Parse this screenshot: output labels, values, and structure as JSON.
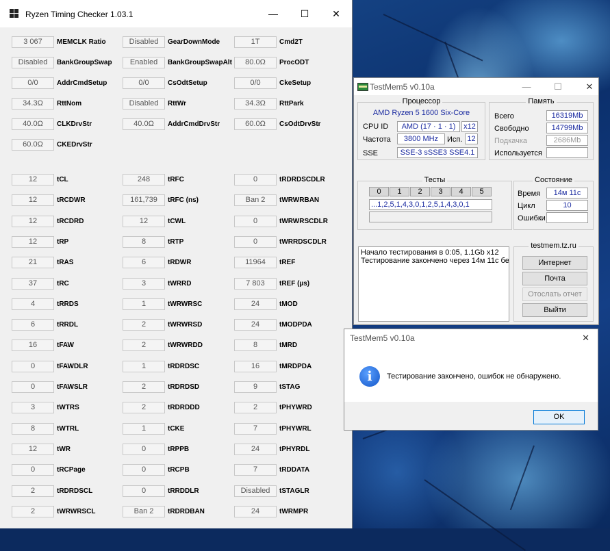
{
  "rtc": {
    "title": "Ryzen Timing Checker 1.03.1",
    "minimize": "—",
    "maximize": "☐",
    "close": "✕",
    "col1": [
      {
        "value": "3 067",
        "label": "MEMCLK Ratio"
      },
      {
        "value": "Disabled",
        "label": "BankGroupSwap"
      },
      {
        "value": "0/0",
        "label": "AddrCmdSetup"
      },
      {
        "value": "34.3Ω",
        "label": "RttNom"
      },
      {
        "value": "40.0Ω",
        "label": "CLKDrvStr"
      },
      {
        "value": "60.0Ω",
        "label": "CKEDrvStr"
      },
      {
        "value": "12",
        "label": "tCL"
      },
      {
        "value": "12",
        "label": "tRCDWR"
      },
      {
        "value": "12",
        "label": "tRCDRD"
      },
      {
        "value": "12",
        "label": "tRP"
      },
      {
        "value": "21",
        "label": "tRAS"
      },
      {
        "value": "37",
        "label": "tRC"
      },
      {
        "value": "4",
        "label": "tRRDS"
      },
      {
        "value": "6",
        "label": "tRRDL"
      },
      {
        "value": "16",
        "label": "tFAW"
      },
      {
        "value": "0",
        "label": "tFAWDLR"
      },
      {
        "value": "0",
        "label": "tFAWSLR"
      },
      {
        "value": "3",
        "label": "tWTRS"
      },
      {
        "value": "8",
        "label": "tWTRL"
      },
      {
        "value": "12",
        "label": "tWR"
      },
      {
        "value": "0",
        "label": "tRCPage"
      },
      {
        "value": "2",
        "label": "tRDRDSCL"
      },
      {
        "value": "2",
        "label": "tWRWRSCL"
      }
    ],
    "col2": [
      {
        "value": "Disabled",
        "label": "GearDownMode"
      },
      {
        "value": "Enabled",
        "label": "BankGroupSwapAlt"
      },
      {
        "value": "0/0",
        "label": "CsOdtSetup"
      },
      {
        "value": "Disabled",
        "label": "RttWr"
      },
      {
        "value": "40.0Ω",
        "label": "AddrCmdDrvStr"
      },
      {
        "value": "248",
        "label": "tRFC"
      },
      {
        "value": "161,739",
        "label": "tRFC (ns)"
      },
      {
        "value": "12",
        "label": "tCWL"
      },
      {
        "value": "8",
        "label": "tRTP"
      },
      {
        "value": "6",
        "label": "tRDWR"
      },
      {
        "value": "3",
        "label": "tWRRD"
      },
      {
        "value": "1",
        "label": "tWRWRSC"
      },
      {
        "value": "2",
        "label": "tWRWRSD"
      },
      {
        "value": "2",
        "label": "tWRWRDD"
      },
      {
        "value": "1",
        "label": "tRDRDSC"
      },
      {
        "value": "2",
        "label": "tRDRDSD"
      },
      {
        "value": "2",
        "label": "tRDRDDD"
      },
      {
        "value": "1",
        "label": "tCKE"
      },
      {
        "value": "0",
        "label": "tRPPB"
      },
      {
        "value": "0",
        "label": "tRCPB"
      },
      {
        "value": "0",
        "label": "tRRDDLR"
      },
      {
        "value": "Ban 2",
        "label": "tRDRDBAN"
      }
    ],
    "col3": [
      {
        "value": "1T",
        "label": "Cmd2T"
      },
      {
        "value": "80.0Ω",
        "label": "ProcODT"
      },
      {
        "value": "0/0",
        "label": "CkeSetup"
      },
      {
        "value": "34.3Ω",
        "label": "RttPark"
      },
      {
        "value": "60.0Ω",
        "label": "CsOdtDrvStr"
      },
      {
        "value": "0",
        "label": "tRDRDSCDLR"
      },
      {
        "value": "Ban 2",
        "label": "tWRWRBAN"
      },
      {
        "value": "0",
        "label": "tWRWRSCDLR"
      },
      {
        "value": "0",
        "label": "tWRRDSCDLR"
      },
      {
        "value": "11964",
        "label": "tREF"
      },
      {
        "value": "7 803",
        "label": "tREF (µs)"
      },
      {
        "value": "24",
        "label": "tMOD"
      },
      {
        "value": "24",
        "label": "tMODPDA"
      },
      {
        "value": "8",
        "label": "tMRD"
      },
      {
        "value": "16",
        "label": "tMRDPDA"
      },
      {
        "value": "9",
        "label": "tSTAG"
      },
      {
        "value": "2",
        "label": "tPHYWRD"
      },
      {
        "value": "7",
        "label": "tPHYWRL"
      },
      {
        "value": "24",
        "label": "tPHYRDL"
      },
      {
        "value": "7",
        "label": "tRDDATA"
      },
      {
        "value": "Disabled",
        "label": "tSTAGLR"
      },
      {
        "value": "24",
        "label": "tWRMPR"
      }
    ]
  },
  "testmem": {
    "title": "TestMem5 v0.10a",
    "cpu": {
      "group": "Процессор",
      "name": "AMD Ryzen 5 1600 Six-Core",
      "id_label": "CPU ID",
      "id_value": "AMD  (17 · 1 · 1)",
      "threads": "x12",
      "freq_label": "Частота",
      "freq_value": "3800 MHz",
      "used_label": "Исп.",
      "used_value": "12",
      "sse_label": "SSE",
      "sse_value": "SSE-3 sSSE3 SSE4.1"
    },
    "mem": {
      "group": "Память",
      "total_label": "Всего",
      "total_value": "16319Mb",
      "free_label": "Свободно",
      "free_value": "14799Mb",
      "swap_label": "Подкачка",
      "swap_value": "2686Mb",
      "used_label": "Используется",
      "used_value": ""
    },
    "tests": {
      "group": "Тесты",
      "tabs": [
        "0",
        "1",
        "2",
        "3",
        "4",
        "5"
      ],
      "sequence": "...1,2,5,1,4,3,0,1,2,5,1,4,3,0,1"
    },
    "state": {
      "group": "Состояние",
      "time_label": "Время",
      "time_value": "14м 11с",
      "cycle_label": "Цикл",
      "cycle_value": "10",
      "errors_label": "Ошибки",
      "errors_value": ""
    },
    "log": [
      "Начало тестирования в 0:05, 1.1Gb x12",
      "Тестирование закончено через 14м 11с бе"
    ],
    "site": {
      "group": "testmem.tz.ru",
      "internet": "Интернет",
      "mail": "Почта",
      "report": "Отослать отчет",
      "exit": "Выйти"
    }
  },
  "dialog": {
    "title": "TestMem5 v0.10a",
    "close": "✕",
    "icon": "i",
    "message": "Тестирование закончено, ошибок не обнаружено.",
    "ok": "OK"
  }
}
